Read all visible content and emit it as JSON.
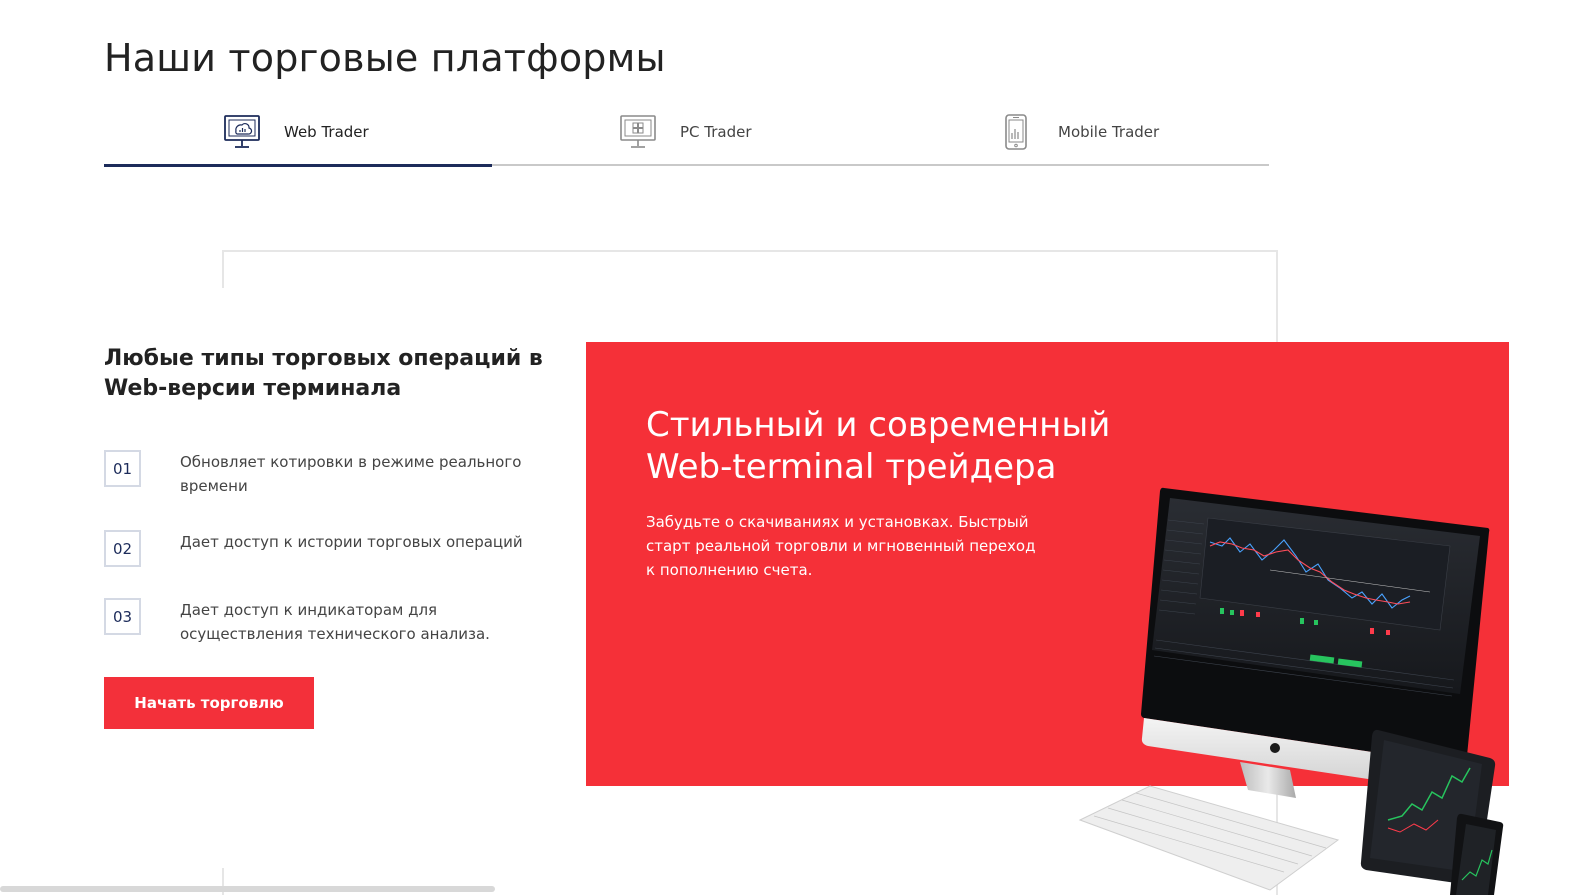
{
  "page": {
    "title": "Наши торговые платформы"
  },
  "tabs": [
    {
      "label": "Web Trader",
      "icon": "web-monitor-icon",
      "active": true
    },
    {
      "label": "PC Trader",
      "icon": "pc-monitor-icon",
      "active": false
    },
    {
      "label": "Mobile Trader",
      "icon": "mobile-phone-icon",
      "active": false
    }
  ],
  "features": {
    "title": "Любые типы торговых операций в Web-версии терминала",
    "items": [
      {
        "num": "01",
        "text": "Обновляет котировки в режиме реального времени"
      },
      {
        "num": "02",
        "text": "Дает доступ к истории торговых операций"
      },
      {
        "num": "03",
        "text": "Дает доступ к индикаторам для осуществления технического анализа."
      }
    ],
    "button_label": "Начать торговлю"
  },
  "promo": {
    "title": "Стильный и современный Web-terminal трейдера",
    "text": "Забудьте о скачиваниях и установках. Быстрый старт реальной торговли и мгновенный переход к пополнению счета.",
    "image": "devices-illustration"
  },
  "colors": {
    "accent_red": "#f53038",
    "button_red": "#f3303a",
    "navy": "#1c2b5a",
    "border_grey": "#c9c9c9"
  }
}
